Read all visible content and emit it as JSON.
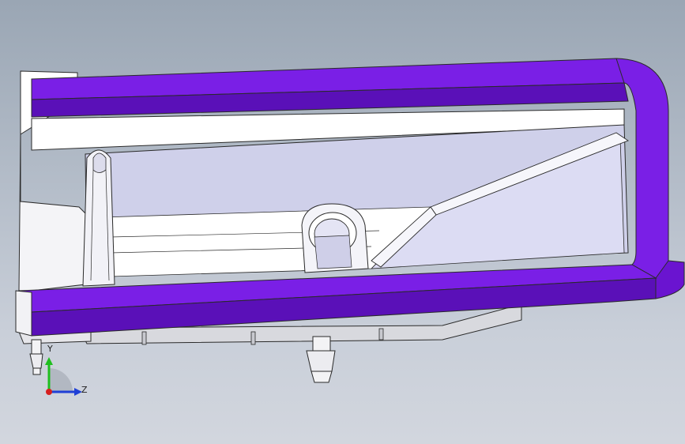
{
  "viewport": {
    "background_top": "#9aa6b4",
    "background_bottom": "#d2d6de"
  },
  "model": {
    "rim_color": "#7a1fe6",
    "rim_shade_color": "#5a10b8",
    "body_color": "#ffffff",
    "inner_wall_color": "#cfd0ea",
    "edge_color": "#2a2a2a"
  },
  "triad": {
    "y_label": "Y",
    "z_label": "Z",
    "y_color": "#1fbf1f",
    "z_color": "#1f3fd6",
    "x_color": "#d61f1f"
  }
}
